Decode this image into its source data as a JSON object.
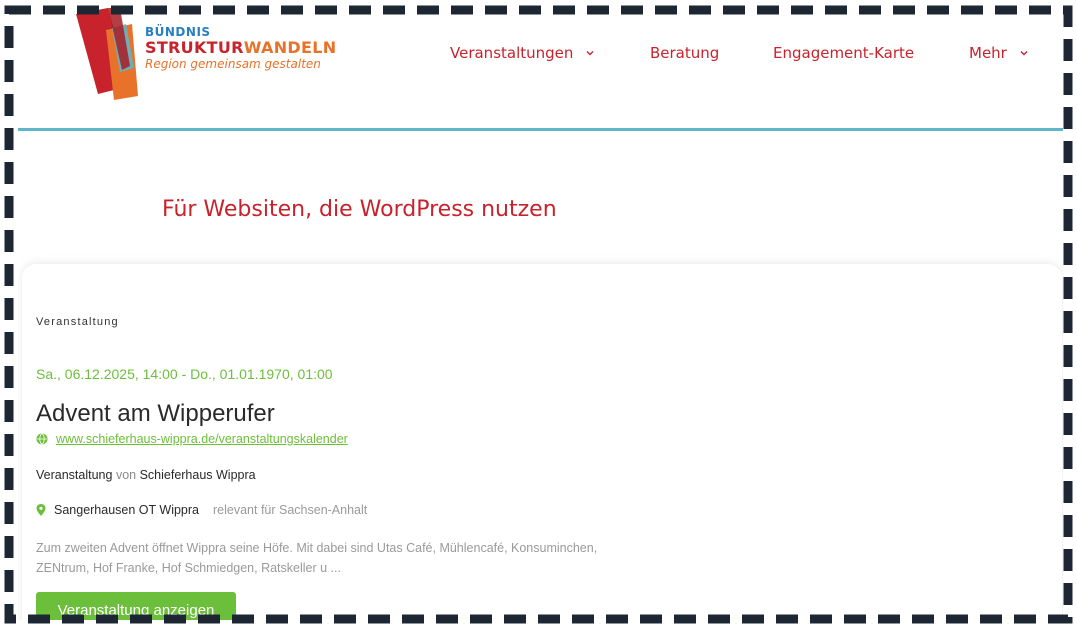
{
  "brand": {
    "line1": "BÜNDNIS",
    "line2_a": "STRUKTUR",
    "line2_b": "WANDELN",
    "tagline": "Region gemeinsam gestalten",
    "colors": {
      "red": "#c8232c",
      "orange": "#e8722a",
      "blue": "#2a7fc0",
      "teal": "#5fb6c9",
      "green": "#6cbf3a"
    }
  },
  "nav": {
    "items": [
      {
        "label": "Veranstaltungen",
        "has_dropdown": true
      },
      {
        "label": "Beratung",
        "has_dropdown": false
      },
      {
        "label": "Engagement-Karte",
        "has_dropdown": false
      },
      {
        "label": "Mehr",
        "has_dropdown": true
      }
    ]
  },
  "section": {
    "heading": "Für Websiten, die WordPress nutzen"
  },
  "event": {
    "type": "Veranstaltung",
    "date_range": "Sa., 06.12.2025, 14:00 - Do., 01.01.1970, 01:00",
    "title": "Advent am Wipperufer",
    "link_icon": "globe-icon",
    "link": "www.schieferhaus-wippra.de/veranstaltungskalender",
    "organizer_prefix": "Veranstaltung",
    "organizer_by": "von",
    "organizer_name": "Schieferhaus Wippra",
    "location_icon": "map-pin-icon",
    "location": "Sangerhausen OT Wippra",
    "relevance": "relevant für Sachsen-Anhalt",
    "description_line1": "Zum zweiten Advent öffnet Wippra seine Höfe. Mit dabei sind Utas Café, Mühlencafé, Konsuminchen,",
    "description_line2": "ZENtrum, Hof Franke, Hof Schmiedgen, Ratskeller u ...",
    "button_label": "Veranstaltung anzeigen"
  }
}
